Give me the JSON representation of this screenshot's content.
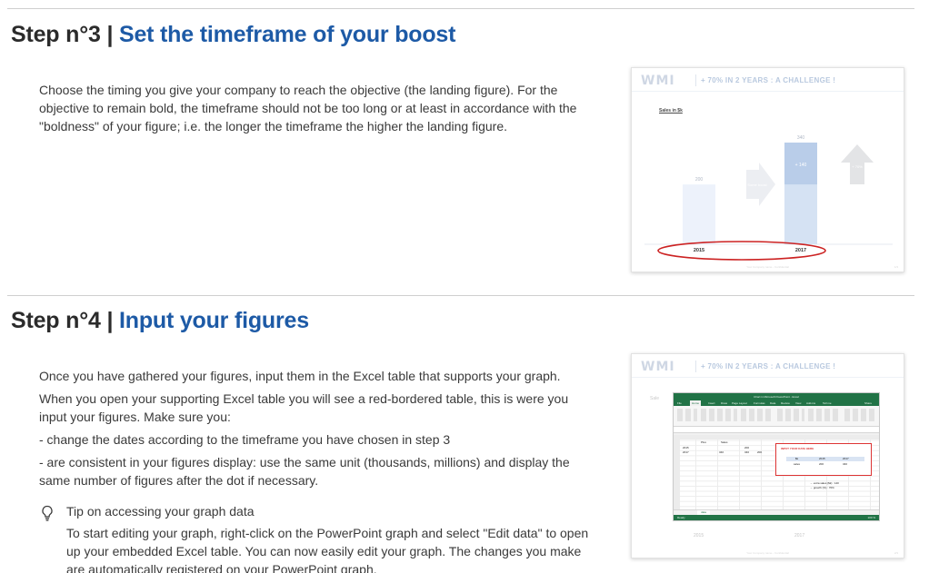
{
  "step3": {
    "number": "Step n°3",
    "separator": "|",
    "title": "Set the timeframe of your boost",
    "paragraph": "Choose the timing you give your company to reach the objective (the landing figure). For the objective to remain bold, the timeframe should not be too long or at least in accordance with the \"boldness\" of your figure; i.e. the longer the timeframe the higher the landing figure.",
    "slide": {
      "logo": "WMI",
      "banner": "+ 70% IN 2 YEARS : A CHALLENGE !",
      "chart_title": "Sales in $k",
      "arrow_text": "Some boost",
      "boost_label": "+ 140",
      "growth_label": "+ 70%",
      "footer": "Your Company name - Confidential",
      "page": "1/3"
    }
  },
  "step4": {
    "number": "Step n°4",
    "separator": "|",
    "title": "Input your figures",
    "para1": "Once you have gathered your figures, input them in the Excel table that supports your graph.",
    "para2": "When you open your supporting Excel table you will see a red-bordered table, this is were you input your figures. Make sure you:",
    "bullet1": "- change the dates according to the timeframe you have chosen in step 3",
    "bullet2": "- are consistent in your figures display: use the same unit (thousands, millions) and display the same number of figures after the dot if necessary.",
    "tip_title": "Tip on accessing your graph data",
    "tip_body": "To start editing your graph, right-click on the PowerPoint graph and select \"Edit data\" to open up your embedded Excel table. You can now easily edit your graph. The changes you make are automatically registered on your PowerPoint graph.",
    "slide": {
      "logo": "WMI",
      "banner": "+ 70% IN 2 YEARS : A CHALLENGE !",
      "peek_label": "Sale",
      "excel_title": "Chart in Microsoft PowerPoint - Excel",
      "tabs": [
        "File",
        "Home",
        "Insert",
        "Draw",
        "Page Layout",
        "Formulas",
        "Data",
        "Review",
        "View",
        "Add-ins",
        "Tell me",
        "Share"
      ],
      "input_header": "INPUT YOUR DATA HERE",
      "col_plus": "Plus",
      "col_sales": "Sales",
      "row_labels": [
        "2015",
        "2017"
      ],
      "row_values": [
        "200",
        "340"
      ],
      "small_vals": [
        "340",
        "200"
      ],
      "tbl_head": [
        "$k",
        "2015",
        "2017"
      ],
      "tbl_row": [
        "sales",
        "200",
        "340"
      ],
      "extra_sales": "→ extra sales ($k) : 140",
      "growth": "→ growth (%) : 70%",
      "sheet_tab": "data",
      "status": "Ready",
      "zoom": "100 %",
      "axis": [
        "2015",
        "2017"
      ],
      "footer": "Your Company name - Confidential",
      "page": "2/3"
    }
  },
  "chart_data": {
    "type": "bar",
    "title": "Sales in $k",
    "categories": [
      "2015",
      "2017"
    ],
    "values": [
      200,
      340
    ],
    "annotations": [
      "+ 140",
      "+ 70%"
    ]
  },
  "colors": {
    "accent": "#1d5aa6",
    "excel_green": "#217346",
    "highlight_red": "#cc2222"
  }
}
